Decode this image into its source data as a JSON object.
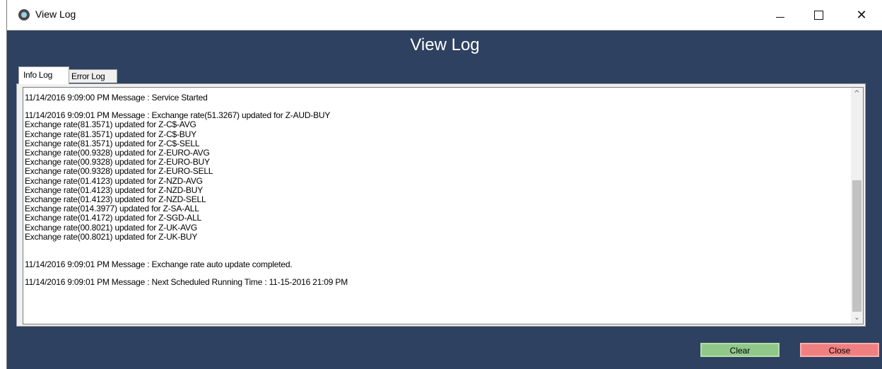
{
  "window": {
    "title": "View Log",
    "controls": {
      "minimize": "—",
      "maximize": "",
      "close": "✕"
    }
  },
  "heading": "View Log",
  "tabs": [
    {
      "label": "Info Log",
      "active": true
    },
    {
      "label": "Error Log",
      "active": false
    }
  ],
  "log": {
    "entry1": "11/14/2016 9:09:00 PM Message : Service Started",
    "entry2_header": "11/14/2016 9:09:01 PM Message : Exchange rate(51.3267) updated for Z-AUD-BUY",
    "entry2_lines": [
      "Exchange rate(81.3571) updated for Z-C$-AVG",
      "Exchange rate(81.3571) updated for Z-C$-BUY",
      "Exchange rate(81.3571) updated for Z-C$-SELL",
      "Exchange rate(00.9328) updated for Z-EURO-AVG",
      "Exchange rate(00.9328) updated for Z-EURO-BUY",
      "Exchange rate(00.9328) updated for Z-EURO-SELL",
      "Exchange rate(01.4123) updated for Z-NZD-AVG",
      "Exchange rate(01.4123) updated for Z-NZD-BUY",
      "Exchange rate(01.4123) updated for Z-NZD-SELL",
      "Exchange rate(014.3977) updated for Z-SA-ALL",
      "Exchange rate(01.4172) updated for Z-SGD-ALL",
      "Exchange rate(00.8021) updated for Z-UK-AVG",
      "Exchange rate(00.8021) updated for Z-UK-BUY"
    ],
    "entry3": "11/14/2016 9:09:01 PM Message : Exchange rate auto update completed.",
    "entry4": "11/14/2016 9:09:01 PM Message : Next Scheduled Running Time : 11-15-2016 21:09 PM"
  },
  "scrollbar": {
    "position_fraction": 1.0,
    "visible_fraction": 0.62,
    "up_arrow": "^",
    "down_arrow": "⌄"
  },
  "buttons": {
    "clear": "Clear",
    "close": "Close"
  },
  "colors": {
    "background": "#2f4160",
    "clear_button": "#90c88a",
    "close_button": "#f08080"
  }
}
